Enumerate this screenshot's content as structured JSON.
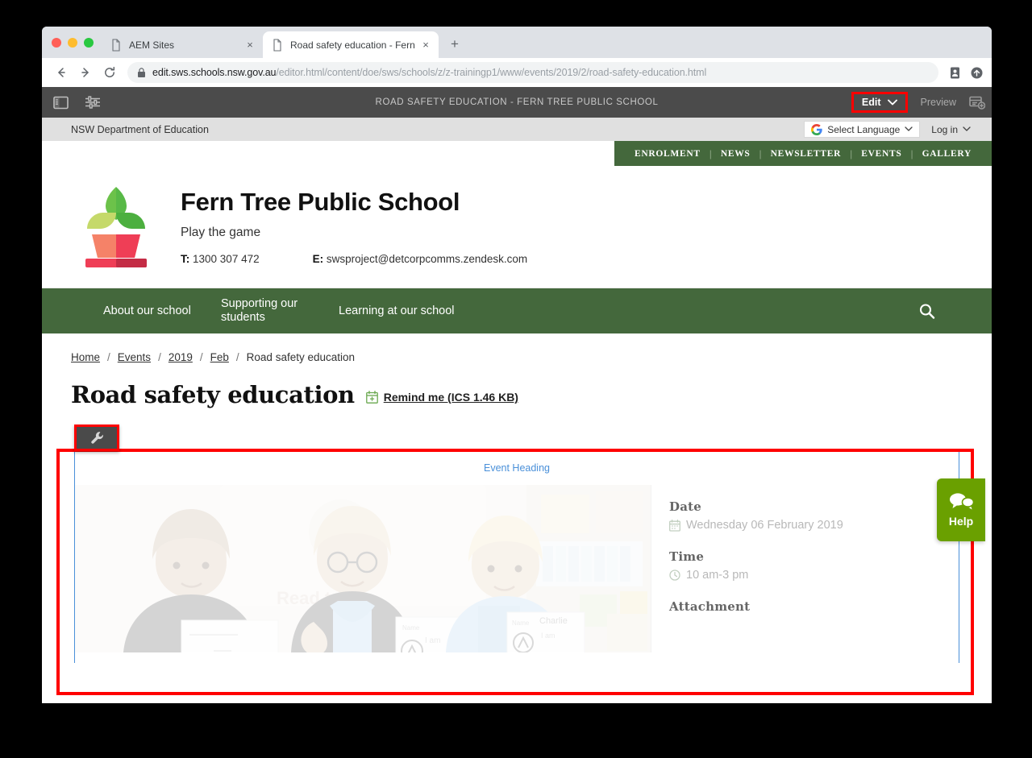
{
  "browser": {
    "tabs": [
      {
        "title": "AEM Sites",
        "active": false,
        "favicon": "page-icon"
      },
      {
        "title": "Road safety education - Fern T",
        "active": true,
        "favicon": "page-icon"
      }
    ],
    "new_tab_label": "+",
    "close_label": "×",
    "back_icon": "back-arrow-icon",
    "forward_icon": "forward-arrow-icon",
    "reload_icon": "reload-icon",
    "lock_icon": "lock-icon",
    "url_secure_prefix": "https://",
    "url_host": "edit.sws.schools.nsw.gov.au",
    "url_path": "/editor.html/content/doe/sws/schools/z/z-trainingp1/www/events/2019/2/road-safety-education.html",
    "url_full": "https://edit.sws.schools.nsw.gov.au/editor.html/content/doe/sws/schools/z/z-trainingp1/www/events/2019/2/road-safety-education.html",
    "omni_icons": [
      "profile-card-icon",
      "install-app-icon"
    ]
  },
  "aem": {
    "title": "ROAD SAFETY EDUCATION - FERN TREE PUBLIC SCHOOL",
    "sidebar_toggle_icon": "sidepanel-icon",
    "page_properties_icon": "sliders-icon",
    "edit_label": "Edit",
    "edit_caret": "⌄",
    "preview_label": "Preview",
    "page_info_icon": "add-page-icon",
    "highlight_color": "#ff0000"
  },
  "dept_bar": {
    "text": "NSW Department of Education",
    "language_select_label": "Select Language",
    "google_mark": "G",
    "language_caret": "⌄",
    "login_label": "Log in",
    "login_caret": "⌄"
  },
  "util_nav": {
    "items": [
      "ENROLMENT",
      "NEWS",
      "NEWSLETTER",
      "EVENTS",
      "GALLERY"
    ],
    "separator": "|",
    "bg_color": "#44683c"
  },
  "brand": {
    "logo_icon": "potted-plant-logo",
    "school_name": "Fern Tree Public School",
    "tagline": "Play the game",
    "phone_label": "T:",
    "phone": "1300 307 472",
    "email_label": "E:",
    "email": "swsproject@detcorpcomms.zendesk.com"
  },
  "main_nav": {
    "items": [
      "About our school",
      "Supporting our students",
      "Learning at our school"
    ],
    "search_icon": "search-icon"
  },
  "breadcrumb": {
    "separator": "/",
    "items": [
      {
        "label": "Home",
        "link": true
      },
      {
        "label": "Events",
        "link": true
      },
      {
        "label": "2019",
        "link": true
      },
      {
        "label": "Feb",
        "link": true
      },
      {
        "label": "Road safety education",
        "link": false
      }
    ]
  },
  "page": {
    "title": "Road safety education",
    "remind_label": "Remind me (ICS 1.46 KB)",
    "remind_icon": "calendar-icon"
  },
  "component": {
    "wrench_icon": "wrench-icon",
    "placeholder_label": "Event Heading",
    "outline_color": "#4a90d9",
    "image_alt": "three-students-holding-worksheets",
    "details": [
      {
        "label": "Date",
        "value": "Wednesday 06 February 2019",
        "icon": "calendar-icon"
      },
      {
        "label": "Time",
        "value": "10 am-3 pm",
        "icon": "clock-icon"
      },
      {
        "label": "Attachment",
        "value": "",
        "icon": ""
      }
    ]
  },
  "help_widget": {
    "label": "Help",
    "icon": "chat-bubbles-icon",
    "color": "#6aa000"
  }
}
